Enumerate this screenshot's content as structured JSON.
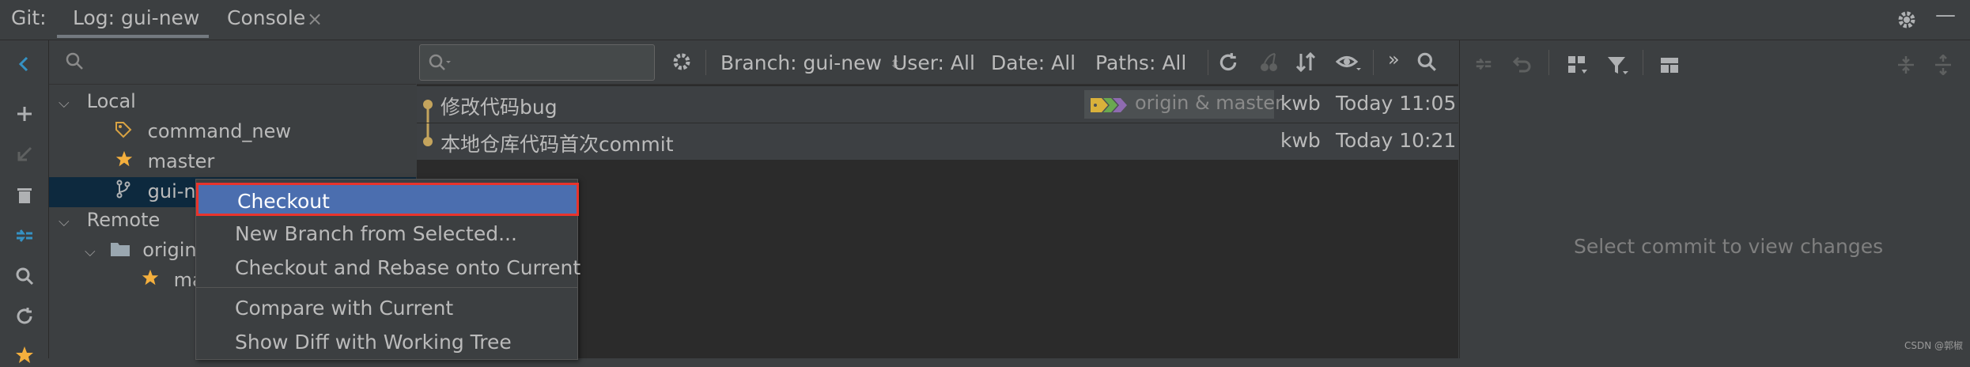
{
  "top": {
    "git_label": "Git:",
    "tab_log": "Log: gui-new",
    "tab_console": "Console",
    "close_glyph": "×",
    "minimize_glyph": "—"
  },
  "branches": {
    "local_label": "Local",
    "local_items": [
      "command_new",
      "master",
      "gui-ne"
    ],
    "remote_label": "Remote",
    "remote_folder": "origin",
    "remote_items": [
      "ma"
    ]
  },
  "log_toolbar": {
    "branch_filter": "Branch: gui-new",
    "user_filter": "User: All",
    "date_filter": "Date: All",
    "paths_filter": "Paths: All",
    "more_glyph": "»"
  },
  "commits": [
    {
      "message": "修改代码bug",
      "refs": "origin & master",
      "author": "kwb",
      "date": "Today 11:05"
    },
    {
      "message": "本地仓库代码首次commit",
      "refs": "",
      "author": "kwb",
      "date": "Today 10:21"
    }
  ],
  "changes": {
    "empty_text": "Select commit to view changes"
  },
  "context_menu": {
    "items": [
      "Checkout",
      "New Branch from Selected...",
      "Checkout and Rebase onto Current",
      "Compare with Current",
      "Show Diff with Working Tree"
    ]
  },
  "watermark": "CSDN @郭椒",
  "colors": {
    "accent_selected": "#4b6eaf",
    "highlight_border": "#e8342c",
    "tag_yellow": "#d9b13b",
    "tag_green": "#6aa84f"
  }
}
